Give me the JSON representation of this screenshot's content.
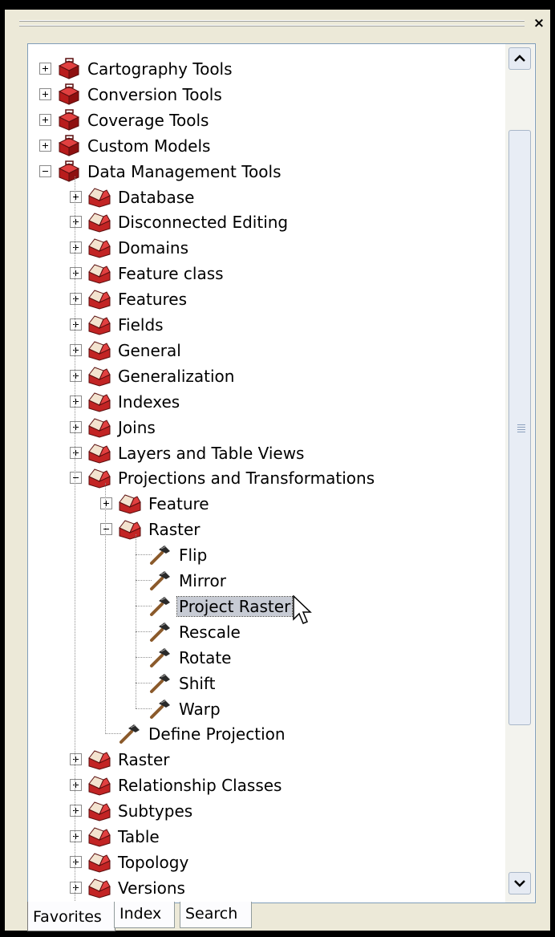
{
  "window": {
    "close_label": "×"
  },
  "tree": {
    "top_items": [
      {
        "label": "Cartography Tools",
        "expanded": false
      },
      {
        "label": "Conversion Tools",
        "expanded": false
      },
      {
        "label": "Coverage Tools",
        "expanded": false
      },
      {
        "label": "Custom Models",
        "expanded": false
      },
      {
        "label": "Data Management Tools",
        "expanded": true
      }
    ],
    "dm_children": [
      {
        "label": "Database"
      },
      {
        "label": "Disconnected Editing"
      },
      {
        "label": "Domains"
      },
      {
        "label": "Feature class"
      },
      {
        "label": "Features"
      },
      {
        "label": "Fields"
      },
      {
        "label": "General"
      },
      {
        "label": "Generalization"
      },
      {
        "label": "Indexes"
      },
      {
        "label": "Joins"
      },
      {
        "label": "Layers and Table Views"
      },
      {
        "label": "Projections and Transformations"
      }
    ],
    "proj_children": [
      {
        "label": "Feature"
      },
      {
        "label": "Raster"
      }
    ],
    "raster_tools": [
      {
        "label": "Flip"
      },
      {
        "label": "Mirror"
      },
      {
        "label": "Project Raster",
        "selected": true
      },
      {
        "label": "Rescale"
      },
      {
        "label": "Rotate"
      },
      {
        "label": "Shift"
      },
      {
        "label": "Warp"
      }
    ],
    "proj_tool": {
      "label": "Define Projection"
    },
    "dm_children_after": [
      {
        "label": "Raster"
      },
      {
        "label": "Relationship Classes"
      },
      {
        "label": "Subtypes"
      },
      {
        "label": "Table"
      },
      {
        "label": "Topology"
      },
      {
        "label": "Versions"
      }
    ]
  },
  "tabs": [
    {
      "label": "Favorites",
      "active": true
    },
    {
      "label": "Index",
      "active": false
    },
    {
      "label": "Search",
      "active": false
    }
  ],
  "icons": {
    "toolbox_open": "toolbox-icon",
    "tool": "hammer-icon",
    "expand": "expand-icon",
    "collapse": "collapse-icon"
  },
  "colors": {
    "toolbox_red": "#c0282a",
    "selection_bg": "#c7cbd4",
    "window_bg": "#ece9d8"
  }
}
